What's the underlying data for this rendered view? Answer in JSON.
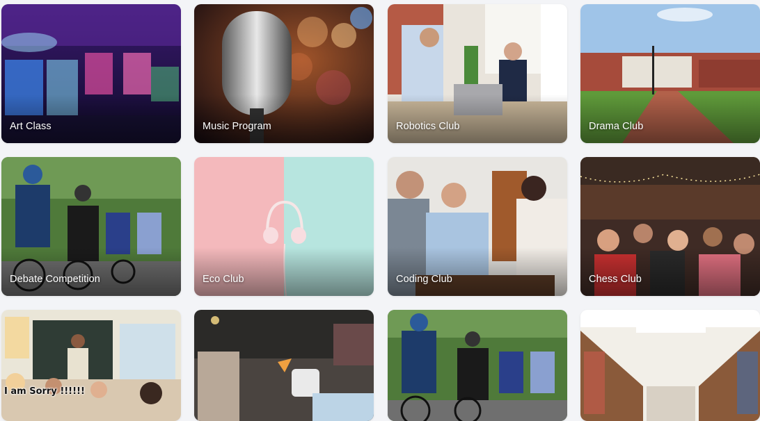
{
  "clubs": [
    {
      "label": "Art Class"
    },
    {
      "label": "Music Program"
    },
    {
      "label": "Robotics Club"
    },
    {
      "label": "Drama Club"
    },
    {
      "label": "Debate Competition"
    },
    {
      "label": "Eco Club"
    },
    {
      "label": "Coding Club"
    },
    {
      "label": "Chess Club"
    },
    {
      "label": ""
    },
    {
      "label": ""
    },
    {
      "label": ""
    },
    {
      "label": ""
    }
  ],
  "overlay_text": "I am Sorry !!!!!!"
}
